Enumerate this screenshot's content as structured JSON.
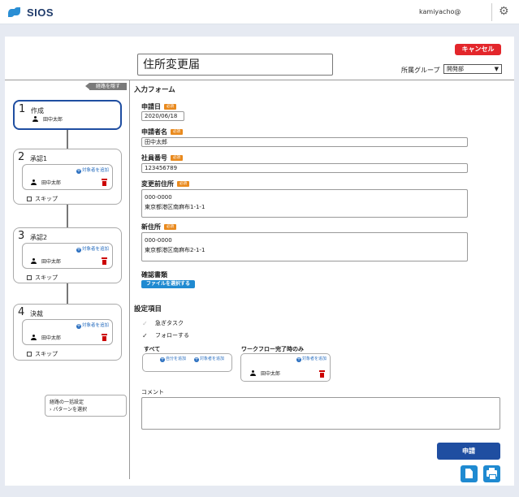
{
  "header": {
    "logo_text": "SIOS",
    "user_name": "kamiyacho@",
    "settings_icon": "gear-icon"
  },
  "form": {
    "cancel_label": "キャンセル",
    "title": "住所変更届",
    "dept_label": "所属グループ",
    "dept_value": "開発部",
    "hide_route_label": "経路を隠す",
    "section_title": "入力フォーム",
    "required_badge": "必須",
    "fields": {
      "apply_date": {
        "label": "申請日",
        "value": "2020/06/18"
      },
      "applicant_name": {
        "label": "申請者名",
        "value": "田中太郎"
      },
      "employee_number": {
        "label": "社員番号",
        "value": "123456789"
      },
      "old_address": {
        "label": "変更前住所",
        "line1": "000-0000",
        "line2": "東京都港区南麻布1-1-1"
      },
      "new_address": {
        "label": "新住所",
        "line1": "000-0000",
        "line2": "東京都港区南麻布2-1-1"
      },
      "confirm_docs": {
        "label": "確認書類",
        "button": "ファイルを選択する"
      }
    },
    "settings": {
      "title": "設定項目",
      "urgent_task": "急ぎタスク",
      "follow": "フォローする",
      "all_label": "すべて",
      "add_self": "自分を追加",
      "add_target": "対象者を追加",
      "wf_complete_label": "ワークフロー完了時のみ",
      "wf_person": "田中太郎"
    },
    "comment_label": "コメント",
    "apply_button": "申請"
  },
  "route": {
    "add_target": "対象者を追加",
    "skip_label": "スキップ",
    "steps": [
      {
        "num": "1",
        "name": "作成",
        "person": "田中太郎"
      },
      {
        "num": "2",
        "name": "承認1",
        "person": "田中太郎"
      },
      {
        "num": "3",
        "name": "承認2",
        "person": "田中太郎"
      },
      {
        "num": "4",
        "name": "決裁",
        "person": "田中太郎"
      }
    ],
    "bulk_title": "経路の一括設定",
    "bulk_pattern": "パターンを選択"
  },
  "colors": {
    "accent": "#1f4ea1",
    "link": "#2a6fc0",
    "cancel": "#e3262b",
    "required": "#e98a1e",
    "file_button": "#1f8ad1"
  }
}
